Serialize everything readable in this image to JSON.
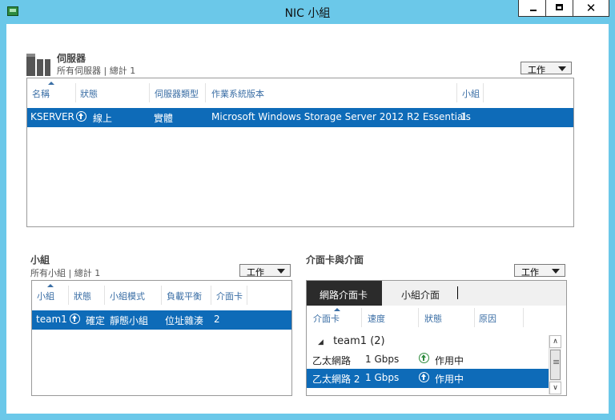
{
  "window": {
    "title": "NIC 小組",
    "controls": [
      "minimize-icon",
      "maximize-icon",
      "close-icon"
    ],
    "close_glyph": "✕"
  },
  "servers": {
    "title": "伺服器",
    "subtitle": "所有伺服器 | 總計 1",
    "tasks_label": "工作",
    "columns": [
      "名稱",
      "狀態",
      "伺服器類型",
      "作業系統版本",
      "小組"
    ],
    "rows": [
      {
        "name": "KSERVER",
        "status": "線上",
        "type": "實體",
        "os": "Microsoft Windows Storage Server 2012 R2 Essentials",
        "teams": "1"
      }
    ]
  },
  "teams": {
    "title": "小組",
    "subtitle": "所有小組 | 總計 1",
    "tasks_label": "工作",
    "columns": [
      "小組",
      "狀態",
      "小組模式",
      "負載平衡",
      "介面卡"
    ],
    "rows": [
      {
        "team": "team1",
        "status": "確定",
        "mode": "靜態小組",
        "lb": "位址雜湊",
        "adapters": "2"
      }
    ]
  },
  "adapters": {
    "title": "介面卡與介面",
    "tasks_label": "工作",
    "tabs": [
      "網路介面卡",
      "小組介面"
    ],
    "active_tab": 0,
    "columns": [
      "介面卡",
      "速度",
      "狀態",
      "原因"
    ],
    "group_label": "team1 (2)",
    "rows": [
      {
        "adapter": "乙太網路",
        "speed": "1 Gbps",
        "status": "作用中",
        "reason": ""
      },
      {
        "adapter": "乙太網路 2",
        "speed": "1 Gbps",
        "status": "作用中",
        "reason": ""
      }
    ],
    "selected_row": 1
  },
  "colors": {
    "titlebar": "#6bc8e9",
    "selection": "#0e6bb8",
    "header_text": "#3a6ea5",
    "active_tab": "#2b2b2b",
    "ok_green": "#2e8b3e"
  }
}
